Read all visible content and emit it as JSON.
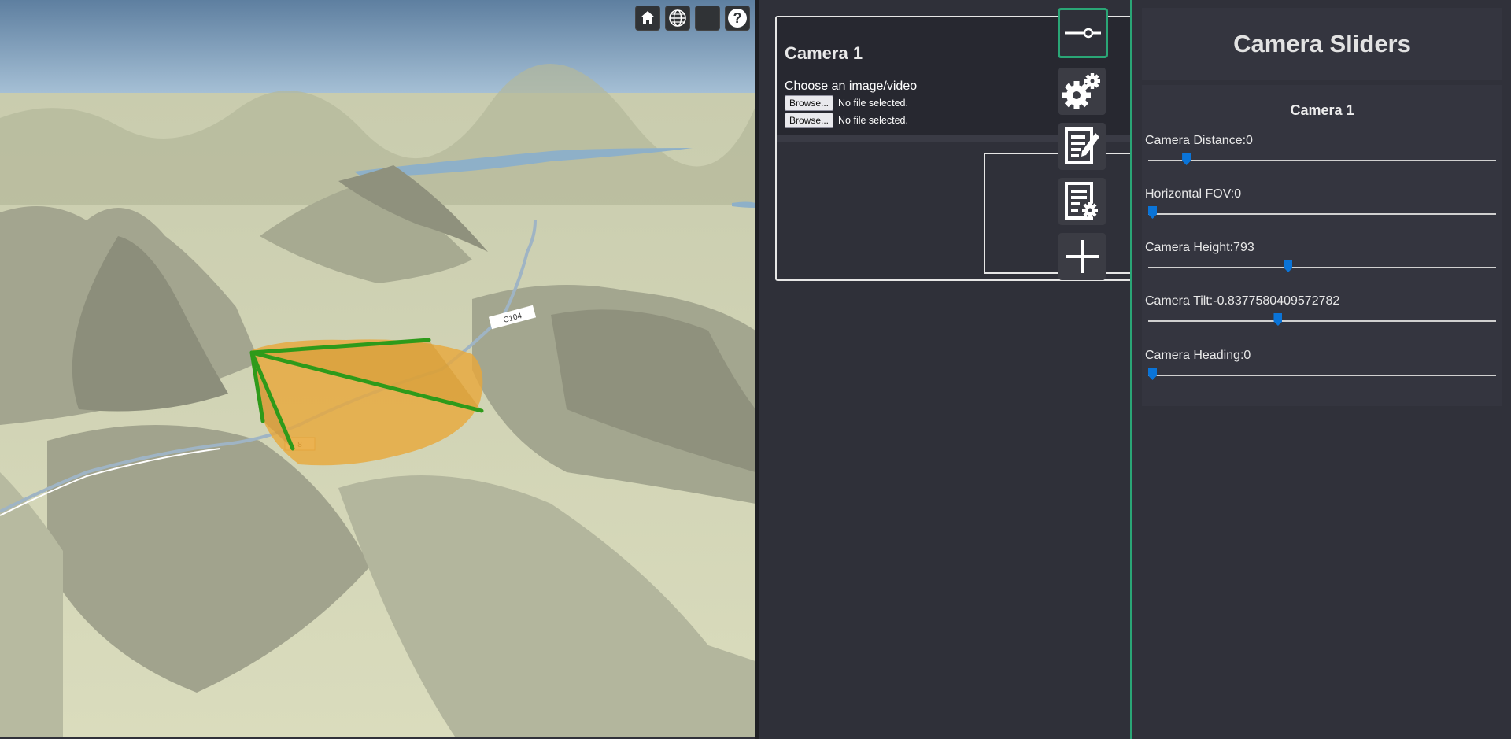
{
  "viewer": {
    "toolbar": [
      {
        "name": "home-icon"
      },
      {
        "name": "globe-icon"
      },
      {
        "name": "layers-button-blank"
      },
      {
        "name": "help-icon",
        "glyph": "?"
      }
    ],
    "road_labels": [
      "C104",
      "8"
    ]
  },
  "camera_panel": {
    "title": "Camera 1",
    "choose_label": "Choose an image/video",
    "browse_label": "Browse...",
    "no_file_text": "No file selected."
  },
  "side_buttons": [
    {
      "name": "sliders-button",
      "active": true
    },
    {
      "name": "settings-button",
      "active": false
    },
    {
      "name": "edit-notes-button",
      "active": false
    },
    {
      "name": "document-settings-button",
      "active": false
    },
    {
      "name": "add-button",
      "active": false
    }
  ],
  "sliders_panel": {
    "title": "Camera Sliders",
    "camera_label": "Camera 1",
    "sliders": [
      {
        "label": "Camera Distance:0",
        "fraction": 0.1
      },
      {
        "label": "Horizontal FOV:0",
        "fraction": 0.0
      },
      {
        "label": "Camera Height:793",
        "fraction": 0.4
      },
      {
        "label": "Camera Tilt:-0.8377580409572782",
        "fraction": 0.37
      },
      {
        "label": "Camera Heading:0",
        "fraction": 0.0
      }
    ]
  },
  "colors": {
    "accent": "#2aa676",
    "slider_thumb": "#0a74d8",
    "frustum_green": "#2e9a1a",
    "footprint_orange": "#e8a83a"
  }
}
